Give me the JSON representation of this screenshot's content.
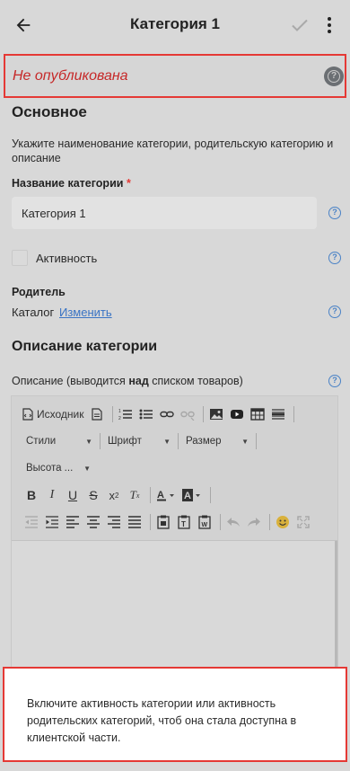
{
  "header": {
    "title": "Категория 1"
  },
  "status": {
    "text": "Не опубликована"
  },
  "main": {
    "section_title": "Основное",
    "description": "Укажите наименование категории, родительскую категорию и описание",
    "name_label": "Название категории",
    "required_mark": "*",
    "name_value": "Категория 1",
    "active_label": "Активность",
    "parent_label": "Родитель",
    "parent_value": "Каталог",
    "parent_change_link": "Изменить"
  },
  "description_section": {
    "title": "Описание категории",
    "label_before": "Описание (выводится ",
    "label_bold": "над",
    "label_after": " списком товаров)"
  },
  "editor": {
    "source_label": "Исходник",
    "styles_label": "Стили",
    "font_label": "Шрифт",
    "size_label": "Размер",
    "height_label": "Высота ..."
  },
  "toast": {
    "message": "Включите активность категории или активность родительских категорий, чтоб она стала доступна в клиентской части."
  },
  "colors": {
    "accent": "#3a74c4",
    "error": "#e53935",
    "toast_bg": "#ffffff"
  }
}
